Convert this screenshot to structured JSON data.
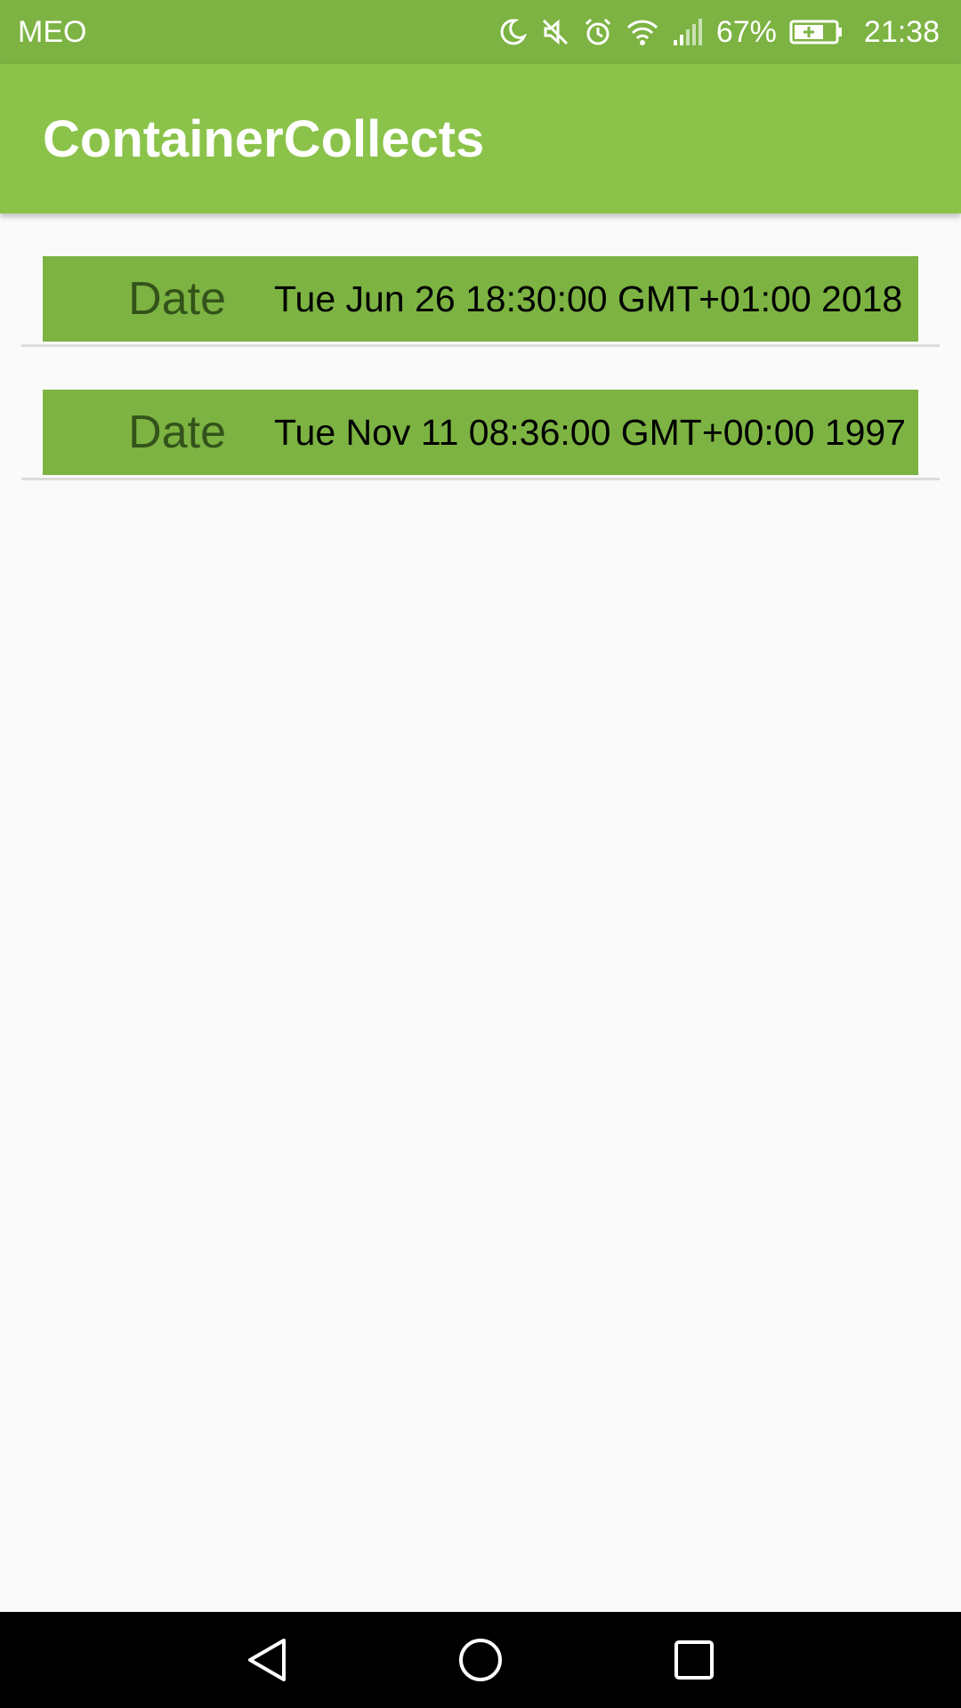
{
  "status_bar": {
    "carrier": "MEO",
    "battery_percent": "67%",
    "time": "21:38",
    "icons": [
      "moon-icon",
      "mute-icon",
      "alarm-icon",
      "wifi-icon",
      "signal-icon",
      "battery-charging-icon"
    ]
  },
  "app_bar": {
    "title": "ContainerCollects"
  },
  "list": {
    "items": [
      {
        "label": "Date",
        "value": "Tue Jun 26 18:30:00 GMT+01:00 2018"
      },
      {
        "label": "Date",
        "value": "Tue Nov 11 08:36:00 GMT+00:00 1997"
      }
    ]
  },
  "nav_bar": {
    "buttons": [
      "back-icon",
      "home-icon",
      "recents-icon"
    ]
  },
  "colors": {
    "status_bar": "#7cb342",
    "app_bar": "#8bc34a",
    "card": "#7cb342",
    "label_text": "#33531a",
    "background": "#fafafa"
  }
}
